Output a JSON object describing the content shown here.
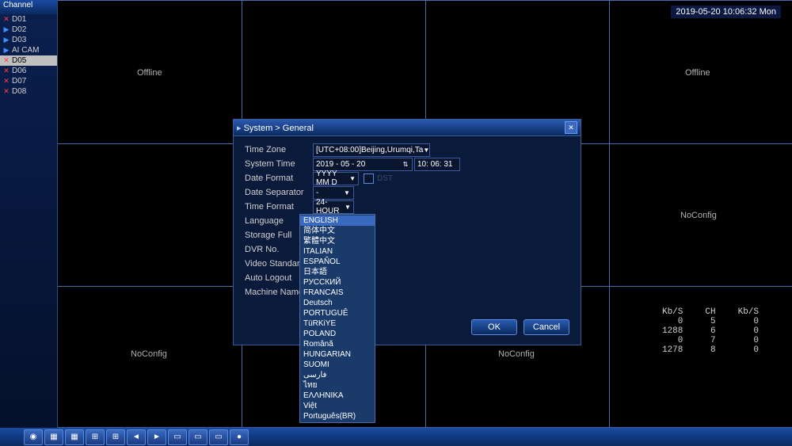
{
  "timestamp": "2019-05-20 10:06:32 Mon",
  "sidebar": {
    "title": "Channel",
    "items": [
      {
        "label": "D01",
        "status": "off"
      },
      {
        "label": "D02",
        "status": "on"
      },
      {
        "label": "D03",
        "status": "on"
      },
      {
        "label": "AI CAM",
        "status": "on"
      },
      {
        "label": "D05",
        "status": "off",
        "selected": true
      },
      {
        "label": "D06",
        "status": "off"
      },
      {
        "label": "D07",
        "status": "off"
      },
      {
        "label": "D08",
        "status": "off"
      }
    ]
  },
  "cells": {
    "offline": "Offline",
    "noconfig": "NoConfig"
  },
  "stats": {
    "headers": [
      "Kb/S",
      "CH",
      "Kb/S"
    ],
    "rows": [
      [
        "0",
        "5",
        "0"
      ],
      [
        "1288",
        "6",
        "0"
      ],
      [
        "0",
        "7",
        "0"
      ],
      [
        "1278",
        "8",
        "0"
      ]
    ]
  },
  "dialog": {
    "title": "System > General",
    "labels": {
      "timezone": "Time Zone",
      "systemtime": "System Time",
      "dateformat": "Date Format",
      "dateseparator": "Date Separator",
      "timeformat": "Time Format",
      "language": "Language",
      "storagefull": "Storage Full",
      "dvrno": "DVR No.",
      "videostandard": "Video Standard",
      "autologout": "Auto Logout",
      "machinename": "Machine Name"
    },
    "values": {
      "timezone": "[UTC+08:00]Beijing,Urumqi,Ta",
      "systemtime_date": "2019 - 05 - 20",
      "systemtime_time": "10: 06: 31",
      "dateformat": "YYYY MM D",
      "dateseparator": "-",
      "timeformat": "24-HOUR",
      "language": "ENGLISH"
    },
    "dst": "DST",
    "ok": "OK",
    "cancel": "Cancel"
  },
  "languages": [
    "ENGLISH",
    "简体中文",
    "繁體中文",
    "ITALIAN",
    "ESPAÑOL",
    "日本語",
    "РУССКИЙ",
    "FRANCAIS",
    "Deutsch",
    "PORTUGUÊ",
    "TüRKiYE",
    "POLAND",
    "Română",
    "HUNGARIAN",
    "SUOMI",
    "فارسی",
    "ไทย",
    "ΕΛΛΗΝΙΚΑ",
    "Việt",
    "Português(BR)"
  ]
}
